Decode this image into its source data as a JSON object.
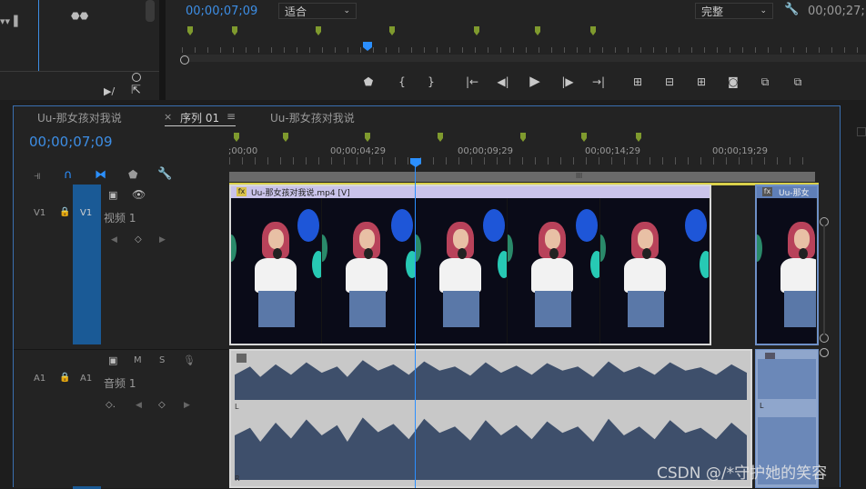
{
  "source_panel": {
    "buttons": [
      "▶/",
      "⇱"
    ]
  },
  "program_monitor": {
    "timecode": "00;00;07;09",
    "fit_label": "适合",
    "quality_label": "完整",
    "end_timecode": "00;00;27;1",
    "controls": [
      "marker",
      "in-point",
      "out-point",
      "go-to-in",
      "step-back",
      "play",
      "step-forward",
      "go-to-out",
      "insert",
      "overwrite",
      "lift",
      "extract",
      "export-frame",
      "compare",
      "multi-camera"
    ]
  },
  "timeline": {
    "tabs": [
      {
        "label": "Uu-那女孩对我说",
        "active": false
      },
      {
        "label": "序列 01",
        "active": true
      },
      {
        "label": "Uu-那女孩对我说",
        "active": false
      }
    ],
    "tab_close": "×",
    "tab_menu": "≡",
    "timecode": "00;00;07;09",
    "ruler_labels": [
      ";00;00",
      "00;00;04;29",
      "00;00;09;29",
      "00;00;14;29",
      "00;00;19;29"
    ],
    "ruler_divider": "III",
    "tracks": {
      "video": {
        "id": "V1",
        "target": "V1",
        "name": "视频 1"
      },
      "audio": {
        "id": "A1",
        "target": "A1",
        "name": "音频 1",
        "mute": "M",
        "solo": "S"
      }
    },
    "video_clip_label": "Uu-那女孩对我说.mp4 [V]",
    "video_clip2_label": "Uu-那女",
    "fx_label": "fx",
    "audio_channel_labels": [
      "L",
      "R"
    ],
    "audio_clip2_label": "L"
  },
  "watermark": "CSDN @/*守护她的笑容",
  "colors": {
    "timecode_blue": "#3d8ee5",
    "marker_green": "#7f9a2e",
    "playhead_blue": "#2b8fff",
    "track_target_blue": "#1a5a96",
    "clip_border": "#d8d8d8"
  }
}
